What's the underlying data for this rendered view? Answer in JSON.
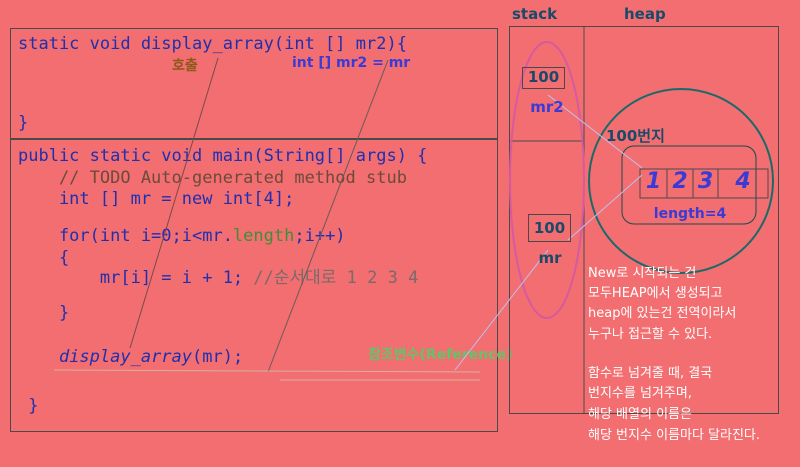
{
  "code_top": {
    "line1": "static void display_array(int [] mr2){",
    "line2": "}"
  },
  "code_main": {
    "line1": "public static void main(String[] args) {",
    "line2": "    // TODO Auto-generated method stub",
    "line3": "    int [] mr = new int[4];",
    "line4a": "    for(int i=0;i<mr.",
    "line4b": "length",
    "line4c": ";i++)",
    "line5": "    {",
    "line6a": "        mr[i] = i + 1; ",
    "line6b": "//순서대로 1 2 3 4",
    "line7": "    }",
    "line8a": "    ",
    "line8b": "display_array",
    "line8c": "(mr);",
    "line9": " }"
  },
  "annotations": {
    "call": "호출",
    "param": "int [] mr2 = mr",
    "reference": "참조변수(Reference)",
    "address": "100번지"
  },
  "memory": {
    "stack_label": "stack",
    "heap_label": "heap",
    "mr2_value": "100",
    "mr2_label": "mr2",
    "mr_value": "100",
    "mr_label": "mr",
    "array_values": [
      "1",
      "2",
      "3",
      "4"
    ],
    "length_label": "length=4"
  },
  "explanation": {
    "line1": "New로 시작되는 건",
    "line2": "모두HEAP에서 생성되고",
    "line3": "heap에 있는건 전역이라서",
    "line4": "누구나 접근할 수 있다.",
    "line5": "함수로 넘겨줄 때, 결국",
    "line6": "번지수를 넘겨주며,",
    "line7": "해당 배열의 이름은",
    "line8": "해당 번지수 이름마다 달라진다."
  }
}
